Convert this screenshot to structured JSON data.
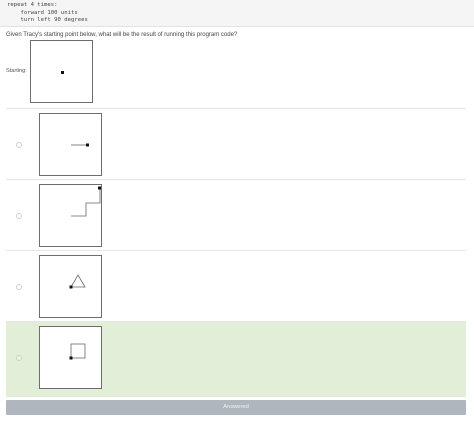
{
  "code": {
    "lines": [
      "repeat 4 times:",
      "    forward 100 units",
      "    turn left 90 degrees"
    ]
  },
  "question": {
    "text": "Given Tracy's starting point below, what will be the result of running this program code?",
    "starting_label": "Starting:"
  },
  "options": [
    {
      "shape": "horizontal-line",
      "selected": false
    },
    {
      "shape": "staircase",
      "selected": false
    },
    {
      "shape": "triangle",
      "selected": false
    },
    {
      "shape": "square",
      "selected": true
    }
  ],
  "submit": {
    "label": "Answered"
  },
  "colors": {
    "selected_bg": "#e3eed8",
    "button_bg": "#b0b6be",
    "stroke": "#666666"
  }
}
